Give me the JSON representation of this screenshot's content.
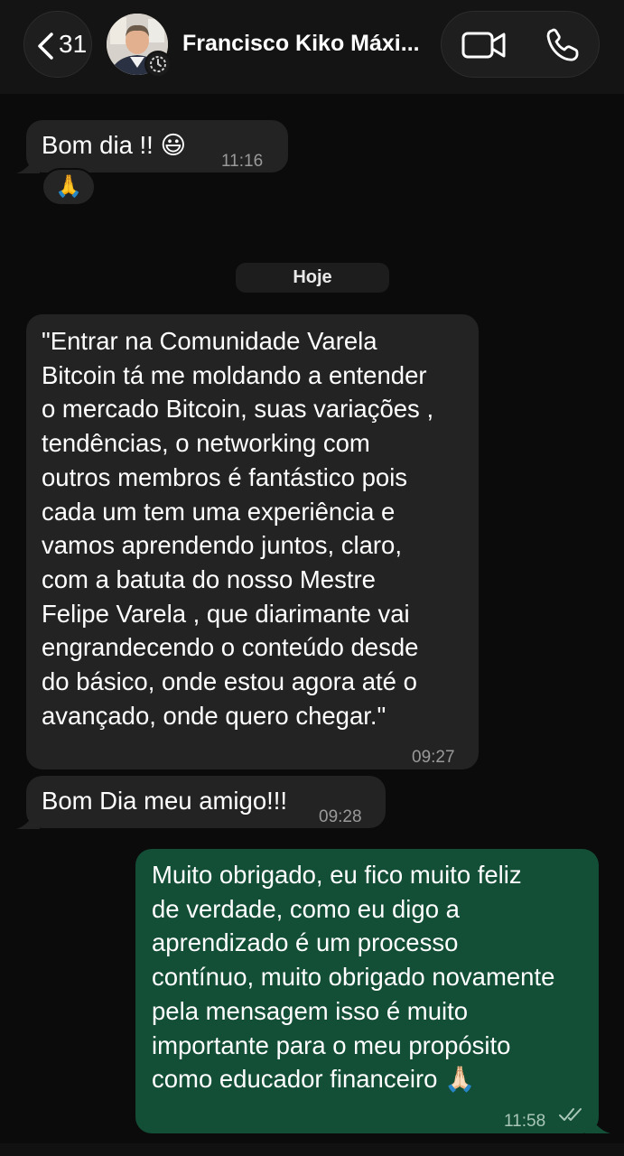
{
  "header": {
    "back_count": "31",
    "contact_name": "Francisco Kiko Máxi...",
    "icons": [
      "chevron-left-icon",
      "video-call-icon",
      "phone-call-icon"
    ]
  },
  "messages": [
    {
      "direction": "incoming",
      "text": "Bom dia !! 😃",
      "time": "11:16",
      "reaction": "🙏"
    },
    {
      "direction": "incoming",
      "text": "\"Entrar na Comunidade Varela\nBitcoin tá me moldando a entender\no mercado Bitcoin, suas variações ,\ntendências, o networking com\noutros membros é fantástico pois\ncada um tem uma experiência e\nvamos aprendendo juntos, claro,\ncom a batuta do nosso Mestre\nFelipe Varela , que diarimante vai\nengrandecendo o conteúdo desde\ndo básico, onde estou agora até o\navançado, onde quero chegar.\"",
      "time": "09:27"
    },
    {
      "direction": "incoming",
      "text": "Bom Dia meu amigo!!!",
      "time": "09:28"
    },
    {
      "direction": "outgoing",
      "text": "Muito obrigado, eu fico muito feliz\nde verdade, como eu digo a\naprendizado é um processo\ncontínuo, muito obrigado novamente\npela mensagem isso é muito\nimportante para o meu propósito\ncomo educador financeiro 🙏🏻",
      "time": "11:58",
      "status": "read"
    }
  ],
  "date_separator": "Hoje",
  "colors": {
    "background": "#0b0b0b",
    "incoming_bubble": "#232323",
    "outgoing_bubble": "#134e36"
  }
}
